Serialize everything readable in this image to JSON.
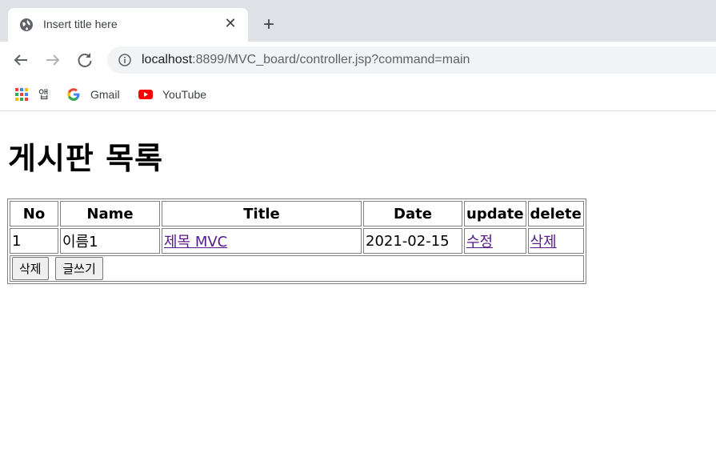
{
  "browser": {
    "tab_title": "Insert title here",
    "url_host": "localhost",
    "url_rest": ":8899/MVC_board/controller.jsp?command=main",
    "bookmarks": [
      {
        "label": "앱",
        "icon": "apps-grid-icon"
      },
      {
        "label": "Gmail",
        "icon": "google-icon"
      },
      {
        "label": "YouTube",
        "icon": "youtube-icon"
      }
    ]
  },
  "page": {
    "heading": "게시판 목록",
    "table": {
      "headers": [
        "No",
        "Name",
        "Title",
        "Date",
        "update",
        "delete"
      ],
      "rows": [
        {
          "no": "1",
          "name": "이름1",
          "title": "제목 MVC",
          "date": "2021-02-15",
          "update": "수정",
          "delete": "삭제"
        }
      ]
    },
    "buttons": {
      "delete_label": "삭제",
      "write_label": "글쓰기"
    }
  }
}
